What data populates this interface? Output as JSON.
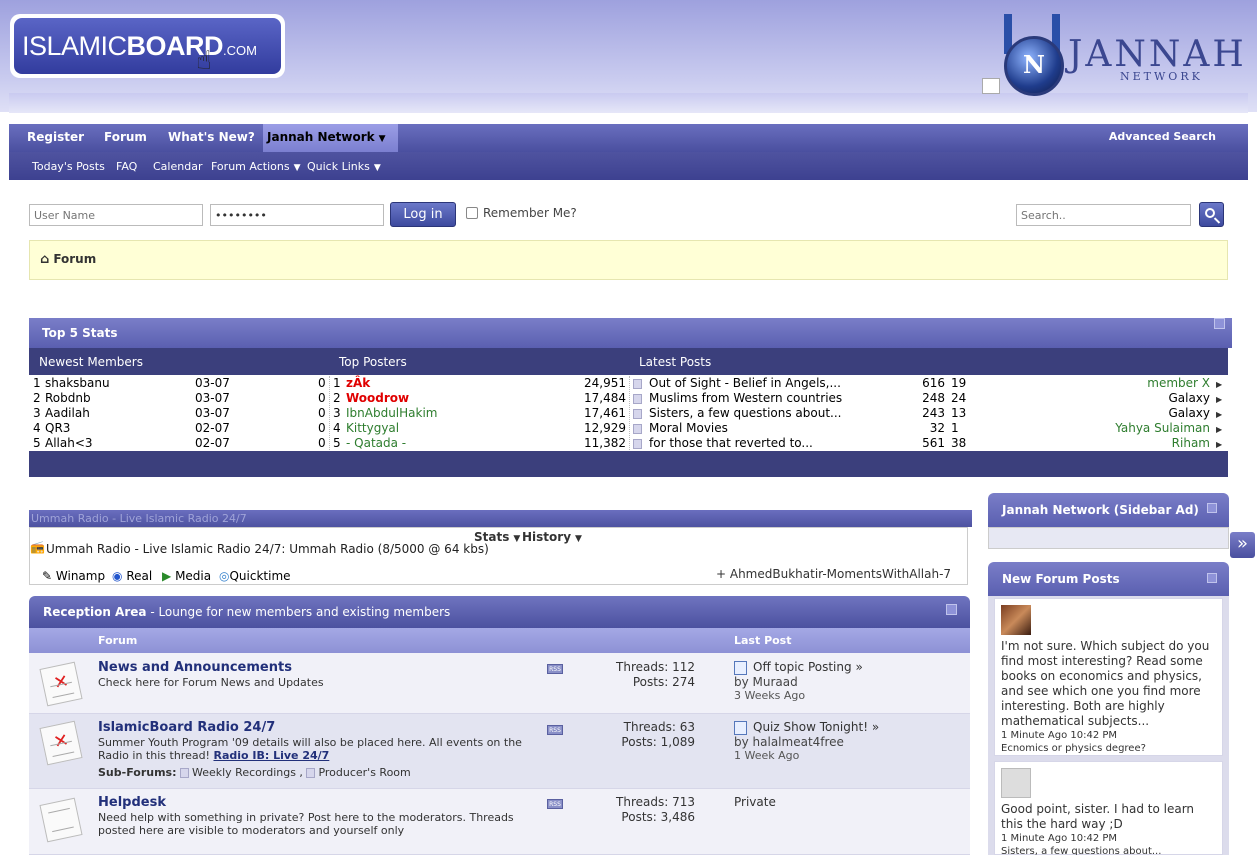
{
  "logo": {
    "text_light": "ISLAMIC",
    "text_bold": "BOARD",
    "text_com": ".COM"
  },
  "jannah": {
    "title": "JANNAH",
    "subtitle": "NETWORK",
    "letter": "N"
  },
  "nav": {
    "primary": [
      "Register",
      "Forum",
      "What's New?",
      "Jannah Network"
    ],
    "advanced_search": "Advanced Search",
    "secondary": [
      "Today's Posts",
      "FAQ",
      "Calendar",
      "Forum Actions",
      "Quick Links"
    ]
  },
  "login": {
    "username_placeholder": "User Name",
    "password_value": "••••••••",
    "login_button": "Log in",
    "remember_label": "Remember Me?"
  },
  "search": {
    "placeholder": "Search.."
  },
  "breadcrumb": {
    "label": "Forum"
  },
  "top5": {
    "title": "Top 5 Stats",
    "columns": [
      "Newest Members",
      "Top Posters",
      "Latest Posts"
    ],
    "newest": [
      {
        "rank": "1",
        "name": "shaksbanu",
        "date": "03-07",
        "posts": "0"
      },
      {
        "rank": "2",
        "name": "Robdnb",
        "date": "03-07",
        "posts": "0"
      },
      {
        "rank": "3",
        "name": "Aadilah",
        "date": "03-07",
        "posts": "0"
      },
      {
        "rank": "4",
        "name": "QR3",
        "date": "02-07",
        "posts": "0"
      },
      {
        "rank": "5",
        "name": "Allah<3",
        "date": "02-07",
        "posts": "0"
      }
    ],
    "posters": [
      {
        "rank": "1",
        "name": "zÂk",
        "count": "24,951"
      },
      {
        "rank": "2",
        "name": "Woodrow",
        "count": "17,484"
      },
      {
        "rank": "3",
        "name": "IbnAbdulHakim",
        "count": "17,461"
      },
      {
        "rank": "4",
        "name": "Kittygyal",
        "count": "12,929"
      },
      {
        "rank": "5",
        "name": "- Qatada -",
        "count": "11,382"
      }
    ],
    "latest": [
      {
        "title": "Out of Sight - Belief in Angels,...",
        "views": "616",
        "replies": "19",
        "user": "member X"
      },
      {
        "title": "Muslims from Western countries",
        "views": "248",
        "replies": "24",
        "user": "Galaxy"
      },
      {
        "title": "Sisters, a few questions about...",
        "views": "243",
        "replies": "13",
        "user": "Galaxy"
      },
      {
        "title": "Moral Movies",
        "views": "32",
        "replies": "1",
        "user": "Yahya Sulaiman"
      },
      {
        "title": "for those that reverted to...",
        "views": "561",
        "replies": "38",
        "user": "Riham"
      }
    ]
  },
  "radio": {
    "header": "Ummah Radio - Live Islamic Radio 24/7",
    "stats_label": "Stats",
    "history_label": "History",
    "station": "Ummah Radio - Live Islamic Radio 24/7: Ummah Radio (8/5000 @ 64 kbs)",
    "players": [
      "Winamp",
      "Real",
      "Media",
      "Quicktime"
    ],
    "now_playing": "+ AhmedBukhatir-MomentsWithAllah-7"
  },
  "forum_section": {
    "title": "Reception Area",
    "subtitle": "- Lounge for new members and existing members",
    "col_forum": "Forum",
    "col_last": "Last Post",
    "forums": [
      {
        "title": "News and Announcements",
        "desc": "Check here for Forum News and Updates",
        "threads": "Threads: 112",
        "posts": "Posts: 274",
        "last_title": "Off topic Posting",
        "last_by": "by Muraad",
        "last_ago": "3 Weeks Ago"
      },
      {
        "title": "IslamicBoard Radio 24/7",
        "desc": "Summer Youth Program '09 details will also be placed here. All events on the Radio in this thread!",
        "desc_link": "Radio IB: Live 24/7",
        "subforums_label": "Sub-Forums:",
        "subforums": [
          "Weekly Recordings",
          "Producer's Room"
        ],
        "threads": "Threads: 63",
        "posts": "Posts: 1,089",
        "last_title": "Quiz Show Tonight!",
        "last_by": "by halalmeat4free",
        "last_ago": "1 Week Ago"
      },
      {
        "title": "Helpdesk",
        "desc": "Need help with something in private? Post here to the moderators. Threads posted here are visible to moderators and yourself only",
        "threads": "Threads: 713",
        "posts": "Posts: 3,486",
        "last_title": "Private"
      }
    ]
  },
  "sidebar": {
    "ad_title": "Jannah Network (Sidebar Ad)",
    "new_posts_title": "New Forum Posts",
    "posts": [
      {
        "text": "I'm not sure. Which subject do you find most interesting? Read some books on economics and physics, and see which one you find more interesting. Both are highly mathematical subjects...",
        "time": "1 Minute Ago 10:42 PM",
        "thread": "Ecnomics or physics degree?"
      },
      {
        "text": "Good point, sister. I had to learn this the hard way ;D",
        "time": "1 Minute Ago 10:42 PM",
        "thread": "Sisters, a few questions about..."
      }
    ]
  }
}
